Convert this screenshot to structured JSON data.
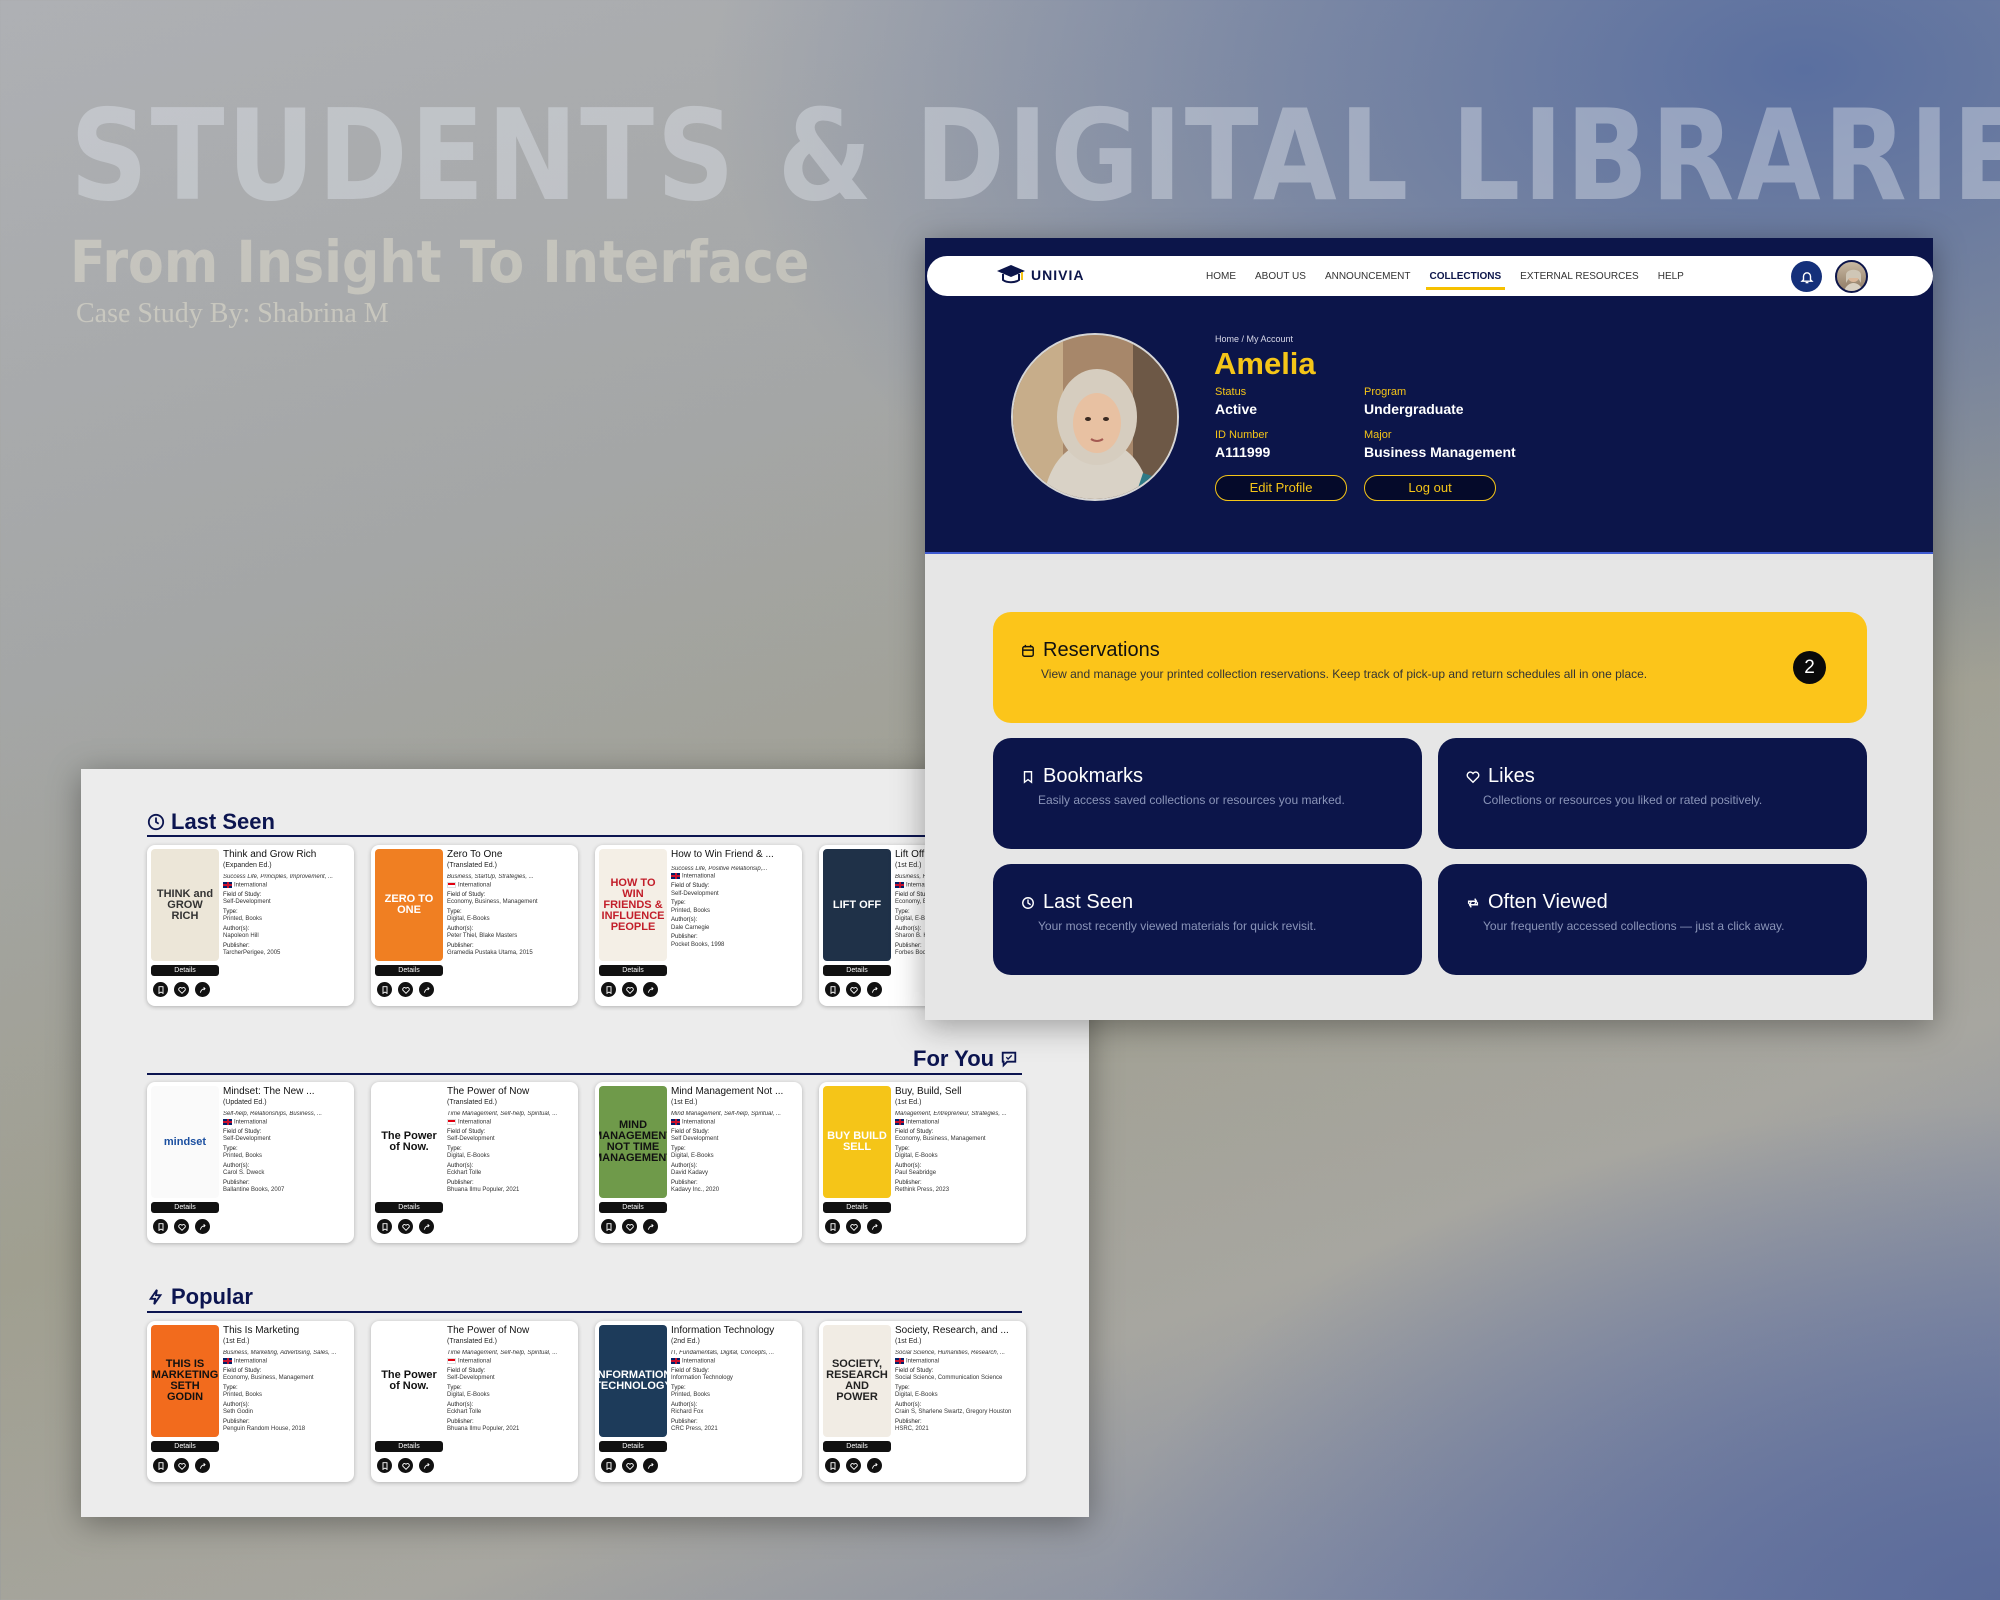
{
  "hero": {
    "title": "STUDENTS & DIGITAL LIBRARIES",
    "subtitle": "From Insight To Interface",
    "case_study": "Case Study By: Shabrina M"
  },
  "library": {
    "sections": [
      {
        "title": "Last Seen",
        "icon": "clock-icon"
      },
      {
        "title": "For You",
        "icon": "chat-icon"
      },
      {
        "title": "Popular",
        "icon": "lightning-icon"
      }
    ],
    "labels": {
      "field": "Field of Study:",
      "type": "Type:",
      "authors": "Author(s):",
      "publisher": "Publisher:",
      "details": "Details"
    },
    "rows": [
      [
        {
          "title": "Think and Grow Rich",
          "edition": "(Expanden Ed.)",
          "subjects": "Success Life, Principles, Improvement, ...",
          "region": "International",
          "flag": "uk",
          "field": "Self-Development",
          "type": "Printed, Books",
          "author": "Napoleon Hill",
          "publisher": "TarcherPerigee, 2005",
          "cover": {
            "bg": "#ece6d8",
            "fg": "#333",
            "text": "THINK and GROW RICH"
          }
        },
        {
          "title": "Zero To One",
          "edition": "(Translated Ed.)",
          "subjects": "Business, StartUp, Strategies, ...",
          "region": "International",
          "flag": "id",
          "field": "Economy, Business, Management",
          "type": "Digital, E-Books",
          "author": "Peter Thiel, Blake Masters",
          "publisher": "Gramedia Pustaka Utama, 2015",
          "cover": {
            "bg": "#f07f22",
            "fg": "#fff",
            "text": "ZERO TO ONE"
          }
        },
        {
          "title": "How to Win Friend & ...",
          "edition": "",
          "subjects": "Success Life, Positive Relationsip,...",
          "region": "International",
          "flag": "uk",
          "field": "Self-Development",
          "type": "Printed, Books",
          "author": "Dale Carnegie",
          "publisher": "Pocket Books, 1998",
          "cover": {
            "bg": "#f4efe6",
            "fg": "#c21e2a",
            "text": "HOW TO WIN FRIENDS & INFLUENCE PEOPLE"
          }
        },
        {
          "title": "Lift Off",
          "edition": "(1st Ed.)",
          "subjects": "Business, F...",
          "region": "International",
          "flag": "uk",
          "field": "Economy, B...",
          "type": "Digital, E-B...",
          "author": "Sharon B. H...",
          "publisher": "Forbes Book...",
          "cover": {
            "bg": "#1f3148",
            "fg": "#fff",
            "text": "LIFT OFF"
          }
        }
      ],
      [
        {
          "title": "Mindset: The New ...",
          "edition": "(Updated Ed.)",
          "subjects": "Self-help, Relationships, Business, ...",
          "region": "International",
          "flag": "uk",
          "field": "Self-Development",
          "type": "Printed, Books",
          "author": "Carol S. Dweck",
          "publisher": "Ballantine Books, 2007",
          "cover": {
            "bg": "#fafafa",
            "fg": "#1b4fa0",
            "text": "mindset"
          }
        },
        {
          "title": "The Power of Now",
          "edition": "(Translated Ed.)",
          "subjects": "Time Management, Self-help, Spiritual, ...",
          "region": "International",
          "flag": "id",
          "field": "Self-Development",
          "type": "Digital, E-Books",
          "author": "Eckhart Tolle",
          "publisher": "Bhuana Ilmu Populer, 2021",
          "cover": {
            "bg": "#fff",
            "fg": "#111",
            "text": "The Power of Now."
          }
        },
        {
          "title": "Mind Management Not ...",
          "edition": "(1st Ed.)",
          "subjects": "Mind Management, Self-help, Spiritual, ...",
          "region": "International",
          "flag": "uk",
          "field": "Self Development",
          "type": "Digital, E-Books",
          "author": "David Kadavy",
          "publisher": "Kadavy Inc., 2020",
          "cover": {
            "bg": "#6f9a4a",
            "fg": "#111",
            "text": "MIND MANAGEMENT NOT TIME MANAGEMENT"
          }
        },
        {
          "title": "Buy, Build, Sell",
          "edition": "(1st Ed.)",
          "subjects": "Management, Entrepreneur, Strategies, ...",
          "region": "International",
          "flag": "uk",
          "field": "Economy, Business, Management",
          "type": "Digital, E-Books",
          "author": "Paul Seabridge",
          "publisher": "Rethink Press, 2023",
          "cover": {
            "bg": "#f5c518",
            "fg": "#fff",
            "text": "BUY BUILD SELL"
          }
        }
      ],
      [
        {
          "title": "This Is Marketing",
          "edition": "(1st Ed.)",
          "subjects": "Business, Marketing, Advertising, Sales, ...",
          "region": "International",
          "flag": "uk",
          "field": "Economy, Business, Management",
          "type": "Printed, Books",
          "author": "Seth Godin",
          "publisher": "Penguin Random House, 2018",
          "cover": {
            "bg": "#f26b1d",
            "fg": "#111",
            "text": "THIS IS MARKETING SETH GODIN"
          }
        },
        {
          "title": "The Power of Now",
          "edition": "(Translated Ed.)",
          "subjects": "Time Management, Self-help, Spiritual, ...",
          "region": "International",
          "flag": "id",
          "field": "Self-Development",
          "type": "Digital, E-Books",
          "author": "Eckhart Tolle",
          "publisher": "Bhuana Ilmu Populer, 2021",
          "cover": {
            "bg": "#fff",
            "fg": "#111",
            "text": "The Power of Now."
          }
        },
        {
          "title": "Information Technology",
          "edition": "(2nd Ed.)",
          "subjects": "IT, Fundamentals, Digital, Concepts, ...",
          "region": "International",
          "flag": "uk",
          "field": "Information Technology",
          "type": "Printed, Books",
          "author": "Richard Fox",
          "publisher": "CRC Press, 2021",
          "cover": {
            "bg": "#1d3b5a",
            "fg": "#fff",
            "text": "INFORMATION TECHNOLOGY"
          }
        },
        {
          "title": "Society, Research, and ...",
          "edition": "(1st Ed.)",
          "subjects": "Social Science, Humanities, Research, ...",
          "region": "International",
          "flag": "uk",
          "field": "Social Science, Communication Science",
          "type": "Digital, E-Books",
          "author": "Crain S, Sharlene Swartz, Gregory Houston",
          "publisher": "HSRC, 2021",
          "cover": {
            "bg": "#f1ece4",
            "fg": "#222",
            "text": "SOCIETY, RESEARCH AND POWER"
          }
        }
      ]
    ]
  },
  "account": {
    "logo": "UNIVIA",
    "nav": [
      "HOME",
      "ABOUT US",
      "ANNOUNCEMENT",
      "COLLECTIONS",
      "EXTERNAL RESOURCES",
      "HELP"
    ],
    "active_nav": "COLLECTIONS",
    "breadcrumb": "Home / My Account",
    "name": "Amelia",
    "status_label": "Status",
    "status": "Active",
    "program_label": "Program",
    "program": "Undergraduate",
    "id_label": "ID Number",
    "id": "A111999",
    "major_label": "Major",
    "major": "Business Management",
    "edit_profile": "Edit Profile",
    "logout": "Log out",
    "reservations": {
      "title": "Reservations",
      "desc": "View and manage your printed collection reservations. Keep track of pick-up and return schedules all in one place.",
      "count": "2"
    },
    "tiles": [
      {
        "title": "Bookmarks",
        "desc": "Easily access saved collections or resources you marked.",
        "icon": "bookmark-icon"
      },
      {
        "title": "Likes",
        "desc": "Collections or resources you liked or rated positively.",
        "icon": "heart-icon"
      },
      {
        "title": "Last Seen",
        "desc": "Your most recently viewed materials for quick revisit.",
        "icon": "clock-icon"
      },
      {
        "title": "Often Viewed",
        "desc": "Your frequently accessed collections — just a click away.",
        "icon": "repeat-icon"
      }
    ],
    "colors": {
      "navy": "#0c154a",
      "yellow": "#fcc51a"
    }
  }
}
